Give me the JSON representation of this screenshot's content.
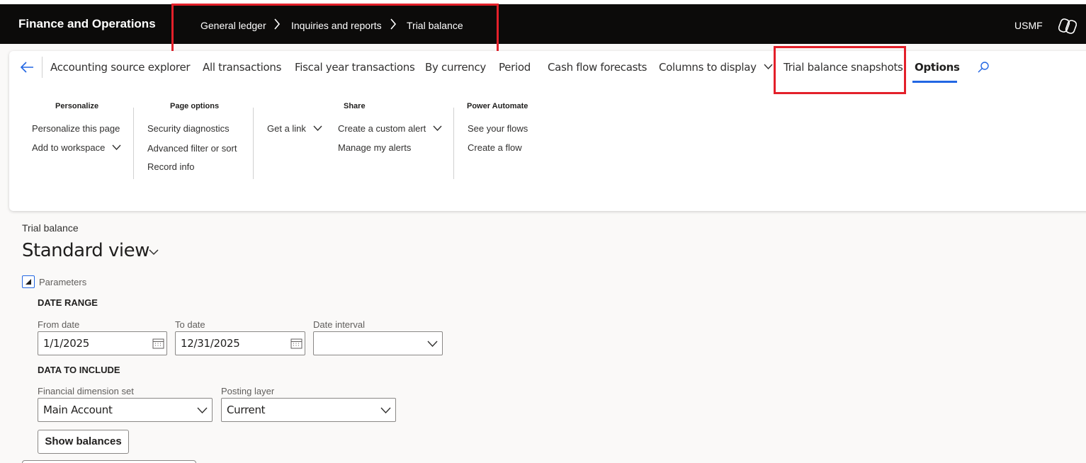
{
  "header": {
    "app_title": "Finance and Operations",
    "breadcrumbs": [
      "General ledger",
      "Inquiries and reports",
      "Trial balance"
    ],
    "company": "USMF"
  },
  "ribbon": {
    "tabs": [
      "Accounting source explorer",
      "All transactions",
      "Fiscal year transactions",
      "By currency",
      "Period",
      "Cash flow forecasts",
      "Columns to display",
      "Trial balance snapshots",
      "Options"
    ],
    "groups": {
      "personalize": {
        "title": "Personalize",
        "items": [
          "Personalize this page",
          "Add to workspace"
        ]
      },
      "page_options": {
        "title": "Page options",
        "items": [
          "Security diagnostics",
          "Advanced filter or sort",
          "Record info"
        ]
      },
      "share": {
        "title": "Share",
        "items": [
          "Get a link",
          "Create a custom alert",
          "Manage my alerts"
        ]
      },
      "power_automate": {
        "title": "Power Automate",
        "items": [
          "See your flows",
          "Create a flow"
        ]
      }
    }
  },
  "page": {
    "caption": "Trial balance",
    "view_name": "Standard view",
    "parameters_label": "Parameters",
    "date_range": {
      "title": "DATE RANGE",
      "from_label": "From date",
      "from_value": "1/1/2025",
      "to_label": "To date",
      "to_value": "12/31/2025",
      "interval_label": "Date interval",
      "interval_value": ""
    },
    "data_to_include": {
      "title": "DATA TO INCLUDE",
      "dimset_label": "Financial dimension set",
      "dimset_value": "Main Account",
      "layer_label": "Posting layer",
      "layer_value": "Current"
    },
    "show_balances": "Show balances"
  },
  "colors": {
    "accent": "#2266e3",
    "highlight": "#e3202a",
    "topbar": "#0c0b0a"
  },
  "icons": [
    "chevron-right-icon",
    "copilot-icon",
    "back-arrow-icon",
    "search-icon",
    "chevron-down-icon",
    "calendar-icon",
    "collapse-triangle-icon"
  ]
}
